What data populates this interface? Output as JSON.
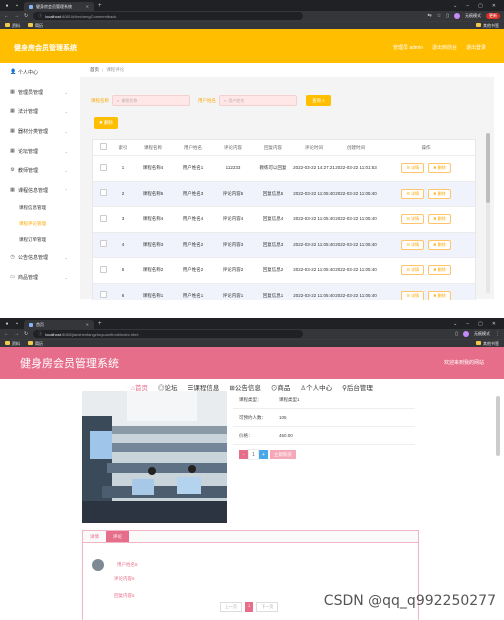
{
  "screenshot1": {
    "tab_title": "健身房会员管理系统",
    "url_host": "localhost",
    "url_path": ":8081/#/kechengCommentback",
    "guest_label": "无痕模式",
    "update_label": "更新",
    "bookmarks": [
      "资料",
      "简历"
    ],
    "other_bookmarks": "其他书签",
    "app_title": "健身房会员管理系统",
    "header_links": [
      "管理员 admin",
      "退出到前台",
      "退出登录"
    ],
    "sidebar": [
      {
        "label": "个人中心",
        "icon": "user-icon"
      },
      {
        "label": "管理员管理",
        "icon": "grid-icon"
      },
      {
        "label": "法计管理",
        "icon": "grid-icon"
      },
      {
        "label": "器材分类管理",
        "icon": "grid-icon"
      },
      {
        "label": "论坛管理",
        "icon": "grid-icon"
      },
      {
        "label": "教师管理",
        "icon": "gear-icon"
      },
      {
        "label": "课程信息管理",
        "icon": "grid-icon"
      }
    ],
    "submenu": [
      "课程信息管理",
      "课程评论管理",
      "课程订单管理"
    ],
    "sidebar_tail": [
      {
        "label": "公告信息管理",
        "icon": "clock-icon"
      },
      {
        "label": "商品管理",
        "icon": "chat-icon"
      }
    ],
    "breadcrumb": {
      "home": "首页",
      "current": "课程评论"
    },
    "search": {
      "label1": "课程名称",
      "placeholder1": "课程名称",
      "label2": "用户姓名",
      "placeholder2": "用户姓名",
      "button": "查询"
    },
    "delete_button": "删除",
    "table": {
      "headers": [
        "",
        "索引",
        "课程名称",
        "用户姓名",
        "评论内容",
        "回复内容",
        "评论时间",
        "创建时间",
        "操作"
      ],
      "detail_label": "详情",
      "delete_label": "删除",
      "rows": [
        [
          "1",
          "课程名称4",
          "用户姓名1",
          "112233",
          "教练可以回复",
          "2022-03-22 14:27:21",
          "2022-03-22 11:01:53"
        ],
        [
          "2",
          "课程名称5",
          "用户姓名3",
          "评论内容5",
          "回复信息5",
          "2022-03-22 11:05:40",
          "2022-03-22 11:05:40"
        ],
        [
          "3",
          "课程名称4",
          "用户姓名4",
          "评论内容4",
          "回复信息4",
          "2022-03-22 11:05:40",
          "2022-03-22 11:05:40"
        ],
        [
          "4",
          "课程名称3",
          "用户姓名2",
          "评论内容3",
          "回复信息3",
          "2022-03-22 11:05:40",
          "2022-03-22 11:05:40"
        ],
        [
          "5",
          "课程名称2",
          "用户姓名2",
          "评论内容2",
          "回复信息2",
          "2022-03-22 11:05:40",
          "2022-03-22 11:05:40"
        ],
        [
          "6",
          "课程名称1",
          "用户姓名1",
          "评论内容1",
          "回复信息1",
          "2022-03-22 11:05:40",
          "2022-03-22 11:05:40"
        ]
      ]
    },
    "colors": {
      "header": "#ffbe00",
      "accent": "#ffa800"
    }
  },
  "screenshot2": {
    "tab_title": "首页",
    "url_host": "localhost",
    "url_path": ":8080/jianshenfangzhuyuan/front/index.html",
    "guest_label": "无痕模式",
    "bookmarks": [
      "资料",
      "简历"
    ],
    "other_bookmarks": "其他书签",
    "app_title": "健身房会员管理系统",
    "welcome": "欢迎来到我的网站",
    "nav": [
      "首页",
      "论坛",
      "课程信息",
      "公告信息",
      "商品",
      "个人中心",
      "后台管理"
    ],
    "info_rows": [
      {
        "key": "课程类型：",
        "value": "课程类型1"
      },
      {
        "key": "可预约人数：",
        "value": "105"
      },
      {
        "key": "价格：",
        "value": "460.00"
      }
    ],
    "quantity": "1",
    "buy_button": "立即购买",
    "tabs": [
      "详情",
      "评论"
    ],
    "comment": {
      "user": "用户姓名5",
      "content": "评论内容5",
      "reply": "回复内容5"
    },
    "pager": {
      "prev": "上一页",
      "page": "1",
      "next": "下一页"
    },
    "watermark": "CSDN @qq_q992250277",
    "colors": {
      "header": "#e66e8a"
    }
  }
}
